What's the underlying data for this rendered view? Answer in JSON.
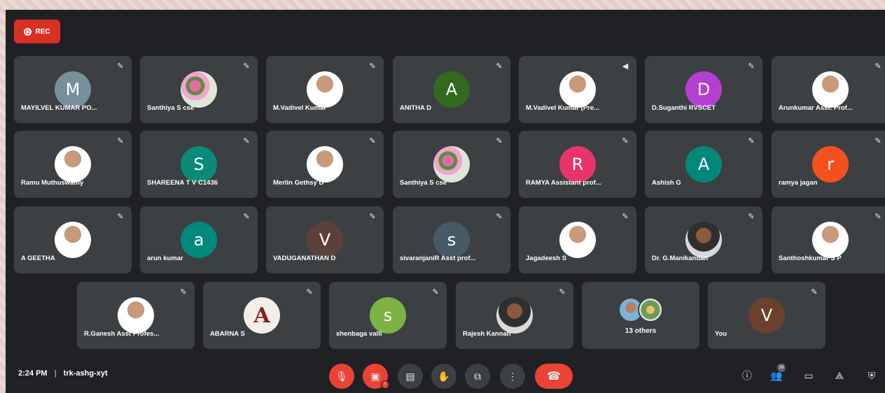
{
  "recording": {
    "label": "REC"
  },
  "tiles": [
    {
      "name": "MAYILVEL KUMAR PO...",
      "initial": "M",
      "color": "#78909c",
      "photo": ""
    },
    {
      "name": "Santhiya S cse",
      "initial": "",
      "color": "",
      "photo": "flower"
    },
    {
      "name": "M.Vadivel Kumar",
      "initial": "",
      "color": "",
      "photo": "person"
    },
    {
      "name": "ANITHA D",
      "initial": "A",
      "color": "#33691e",
      "photo": ""
    },
    {
      "name": "M.Vadivel Kumar (Pre...",
      "initial": "",
      "color": "",
      "photo": "person"
    },
    {
      "name": "D.Suganthi RVSCET",
      "initial": "D",
      "color": "#b43fd1",
      "photo": ""
    },
    {
      "name": "Arunkumar Asst. Prof...",
      "initial": "",
      "color": "",
      "photo": "person"
    },
    {
      "name": "Ramu Muthuswamy",
      "initial": "",
      "color": "",
      "photo": "person"
    },
    {
      "name": "SHAREENA T V C1436",
      "initial": "S",
      "color": "#0b8a78",
      "photo": ""
    },
    {
      "name": "Merlin Gethsy D",
      "initial": "",
      "color": "",
      "photo": "person"
    },
    {
      "name": "Santhiya S cse",
      "initial": "",
      "color": "",
      "photo": "flower"
    },
    {
      "name": "RAMYA Assistant prof...",
      "initial": "R",
      "color": "#e8336b",
      "photo": ""
    },
    {
      "name": "Ashish G",
      "initial": "A",
      "color": "#00897b",
      "photo": ""
    },
    {
      "name": "ramya jagan",
      "initial": "r",
      "color": "#f4511e",
      "photo": ""
    },
    {
      "name": "A GEETHA",
      "initial": "",
      "color": "",
      "photo": "person"
    },
    {
      "name": "arun kumar",
      "initial": "a",
      "color": "#00897b",
      "photo": ""
    },
    {
      "name": "VADUGANATHAN D",
      "initial": "V",
      "color": "#5d4037",
      "photo": ""
    },
    {
      "name": "sivaranjaniR Asst prof...",
      "initial": "s",
      "color": "#455a64",
      "photo": ""
    },
    {
      "name": "Jagadeesh S",
      "initial": "",
      "color": "",
      "photo": "person"
    },
    {
      "name": "Dr. G.Manikandan",
      "initial": "",
      "color": "",
      "photo": "dark"
    },
    {
      "name": "Santhoshkumar S P",
      "initial": "",
      "color": "",
      "photo": "person"
    },
    {
      "name": "R.Ganesh Asst Profes...",
      "initial": "",
      "color": "",
      "photo": "person"
    },
    {
      "name": "ABARNA S",
      "initial": "A",
      "color": "",
      "photo": "letterA"
    },
    {
      "name": "shenbaga valli",
      "initial": "s",
      "color": "#7cb342",
      "photo": ""
    },
    {
      "name": "Rajesh Kannan",
      "initial": "",
      "color": "",
      "photo": "dark"
    },
    {
      "name": "You",
      "initial": "V",
      "color": "#6d3f2f",
      "photo": ""
    }
  ],
  "others": {
    "label": "13 others"
  },
  "bottom": {
    "time": "2:24 PM",
    "separator": "|",
    "meeting_code": "trk-ashg-xyt",
    "participant_count": "39"
  },
  "icons": {
    "mic_muted": "✎",
    "speaker": "◀"
  }
}
